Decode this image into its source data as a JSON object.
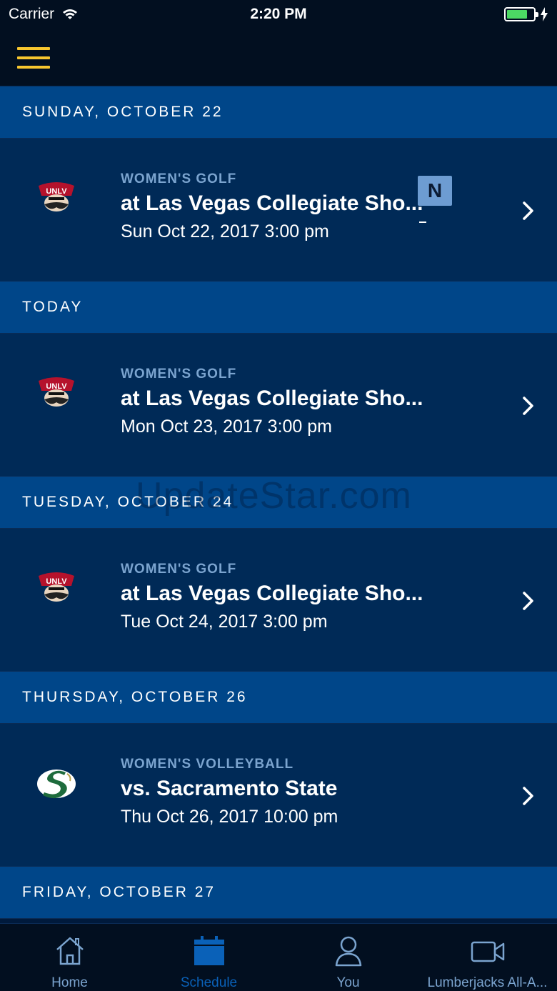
{
  "status_bar": {
    "carrier": "Carrier",
    "time": "2:20 PM"
  },
  "colors": {
    "accent": "#f7c62f",
    "header_bg": "#004689",
    "row_bg": "#002a57",
    "sport_label": "#7ba4cf",
    "active_tab": "#0a61b8",
    "battery": "#4cd964"
  },
  "schedule": {
    "sections": [
      {
        "header": "SUNDAY, OCTOBER 22",
        "events": [
          {
            "sport": "WOMEN'S GOLF",
            "title": "at Las Vegas Collegiate Sho...",
            "date": "Sun Oct 22, 2017 3:00 pm",
            "logo": "unlv-rebels-logo",
            "badge": "N"
          }
        ]
      },
      {
        "header": "TODAY",
        "events": [
          {
            "sport": "WOMEN'S GOLF",
            "title": "at Las Vegas Collegiate Sho...",
            "date": "Mon Oct 23, 2017 3:00 pm",
            "logo": "unlv-rebels-logo"
          }
        ]
      },
      {
        "header": "TUESDAY, OCTOBER 24",
        "events": [
          {
            "sport": "WOMEN'S GOLF",
            "title": "at Las Vegas Collegiate Sho...",
            "date": "Tue Oct 24, 2017 3:00 pm",
            "logo": "unlv-rebels-logo"
          }
        ]
      },
      {
        "header": "THURSDAY, OCTOBER 26",
        "events": [
          {
            "sport": "WOMEN'S VOLLEYBALL",
            "title": "vs. Sacramento State",
            "date": "Thu Oct 26, 2017 10:00 pm",
            "logo": "sacramento-state-logo"
          }
        ]
      },
      {
        "header": "FRIDAY, OCTOBER 27",
        "events": []
      }
    ]
  },
  "watermark": "UpdateStar.com",
  "tab_bar": {
    "tabs": [
      {
        "label": "Home",
        "icon": "home-icon",
        "active": false
      },
      {
        "label": "Schedule",
        "icon": "calendar-icon",
        "active": true
      },
      {
        "label": "You",
        "icon": "person-icon",
        "active": false
      },
      {
        "label": "Lumberjacks All-A...",
        "icon": "video-camera-icon",
        "active": false
      }
    ]
  }
}
